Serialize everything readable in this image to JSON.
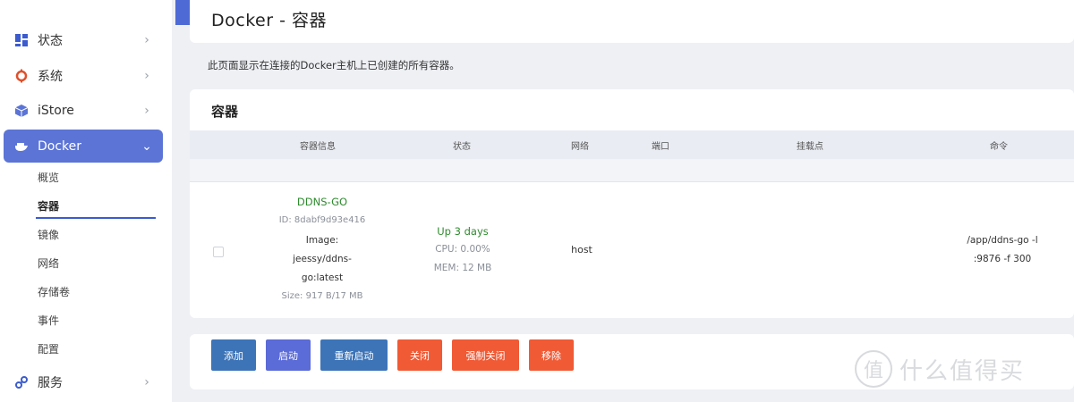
{
  "sidebar": {
    "items": [
      {
        "label": "状态",
        "icon": "dashboard-icon"
      },
      {
        "label": "系统",
        "icon": "system-gear-icon"
      },
      {
        "label": "iStore",
        "icon": "cube-icon"
      },
      {
        "label": "Docker",
        "icon": "docker-whale-icon"
      },
      {
        "label": "服务",
        "icon": "link-icon"
      }
    ],
    "docker_sub": [
      "概览",
      "容器",
      "镜像",
      "网络",
      "存储卷",
      "事件",
      "配置"
    ]
  },
  "page": {
    "title": "Docker - 容器",
    "description": "此页面显示在连接的Docker主机上已创建的所有容器。"
  },
  "containers": {
    "section_title": "容器",
    "columns": [
      "容器信息",
      "状态",
      "网络",
      "端口",
      "挂载点",
      "命令"
    ],
    "rows": [
      {
        "name": "DDNS-GO",
        "id": "ID: 8dabf9d93e416",
        "image_label": "Image:",
        "image_line1": "jeessy/ddns-",
        "image_line2": "go:latest",
        "size": "Size: 917 B/17 MB",
        "status": "Up 3 days",
        "cpu": "CPU: 0.00%",
        "mem": "MEM: 12 MB",
        "network": "host",
        "ports": "",
        "mounts": "",
        "command_line1": "/app/ddns-go -l",
        "command_line2": ":9876 -f 300"
      }
    ]
  },
  "actions": [
    "添加",
    "启动",
    "重新启动",
    "关闭",
    "强制关闭",
    "移除"
  ],
  "watermark": {
    "logo": "值",
    "text": "什么值得买"
  },
  "colors": {
    "accent": "#5b74d6",
    "blue_button": "#3d74b8",
    "violet_button": "#5b6bd8",
    "orange_button": "#f05a35",
    "status_green": "#2e8b2e"
  }
}
